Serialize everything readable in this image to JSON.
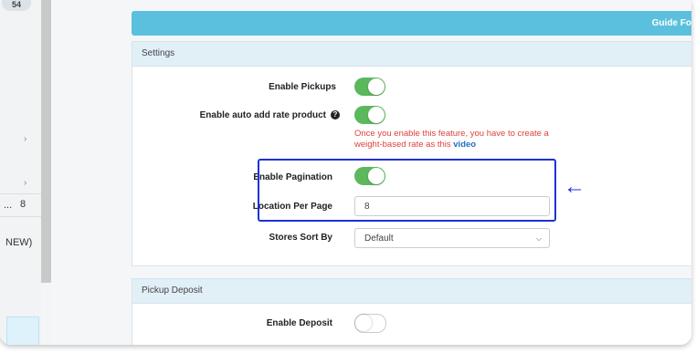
{
  "sidebar": {
    "badge": "54",
    "chevron_1": "›",
    "chevron_2": "›",
    "item_text_1": "...",
    "item_icon": "8",
    "item_text_2": "NEW)"
  },
  "guide_bar": {
    "label": "Guide Fo"
  },
  "settings": {
    "title": "Settings",
    "enable_pickups": {
      "label": "Enable Pickups",
      "state": "on"
    },
    "enable_auto_add": {
      "label": "Enable auto add rate product",
      "state": "on",
      "note_line1": "Once you enable this feature, you have to create a",
      "note_line2": "weight-based rate as this",
      "note_link": "video"
    },
    "enable_pagination": {
      "label": "Enable Pagination",
      "state": "on"
    },
    "location_per_page": {
      "label": "Location Per Page",
      "value": "8"
    },
    "stores_sort_by": {
      "label": "Stores Sort By",
      "value": "Default"
    }
  },
  "pickup_deposit": {
    "title": "Pickup Deposit",
    "enable_deposit": {
      "label": "Enable Deposit",
      "state": "off"
    }
  },
  "colors": {
    "toggle_on": "#5cb85c",
    "guide_bar": "#5bc0de",
    "highlight": "#1c32d8",
    "note": "#e0413a"
  }
}
